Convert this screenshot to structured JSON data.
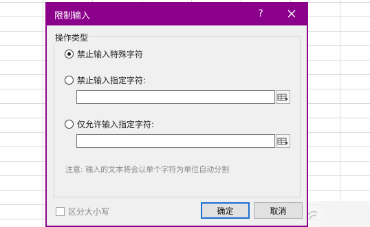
{
  "dialog": {
    "title": "限制输入",
    "help_label": "?",
    "close_icon": "close-icon"
  },
  "operation_group": {
    "title": "操作类型",
    "options": [
      {
        "label": "禁止输入特殊字符",
        "checked": true
      },
      {
        "label": "禁止输入指定字符:",
        "checked": false,
        "value": ""
      },
      {
        "label": "仅允许输入指定字符:",
        "checked": false,
        "value": ""
      }
    ],
    "picker_icon": "range-select-icon",
    "note": "注意: 输入的文本将会以单个字符为单位自动分割"
  },
  "footer": {
    "case_sensitive_label": "区分大小写",
    "case_sensitive_checked": false,
    "ok_label": "确定",
    "cancel_label": "取消"
  },
  "colors": {
    "titlebar": "#8b008b",
    "dialog_bg": "#f0f0f0",
    "primary_button_border": "#1a6fd1"
  }
}
